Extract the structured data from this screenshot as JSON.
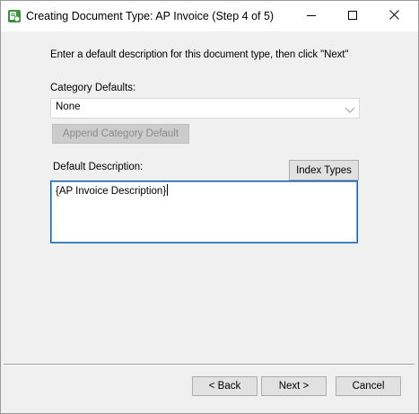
{
  "window": {
    "title": "Creating Document Type: AP Invoice (Step 4 of 5)",
    "icon": "document-type-app-icon",
    "controls": [
      "minimize-icon",
      "maximize-icon",
      "close-icon"
    ]
  },
  "content": {
    "instruction": "Enter a default description for this document type, then click \"Next\"",
    "category_defaults_label": "Category Defaults:",
    "category_defaults_value": "None",
    "append_button_label": "Append Category Default",
    "default_description_label": "Default Description:",
    "index_types_button_label": "Index Types",
    "default_description_value": "{AP Invoice Description}"
  },
  "footer": {
    "back_label": "< Back",
    "next_label": "Next >",
    "cancel_label": "Cancel"
  },
  "colors": {
    "accent_border": "#0f5ea8",
    "disabled_text": "#8a8a8a"
  }
}
